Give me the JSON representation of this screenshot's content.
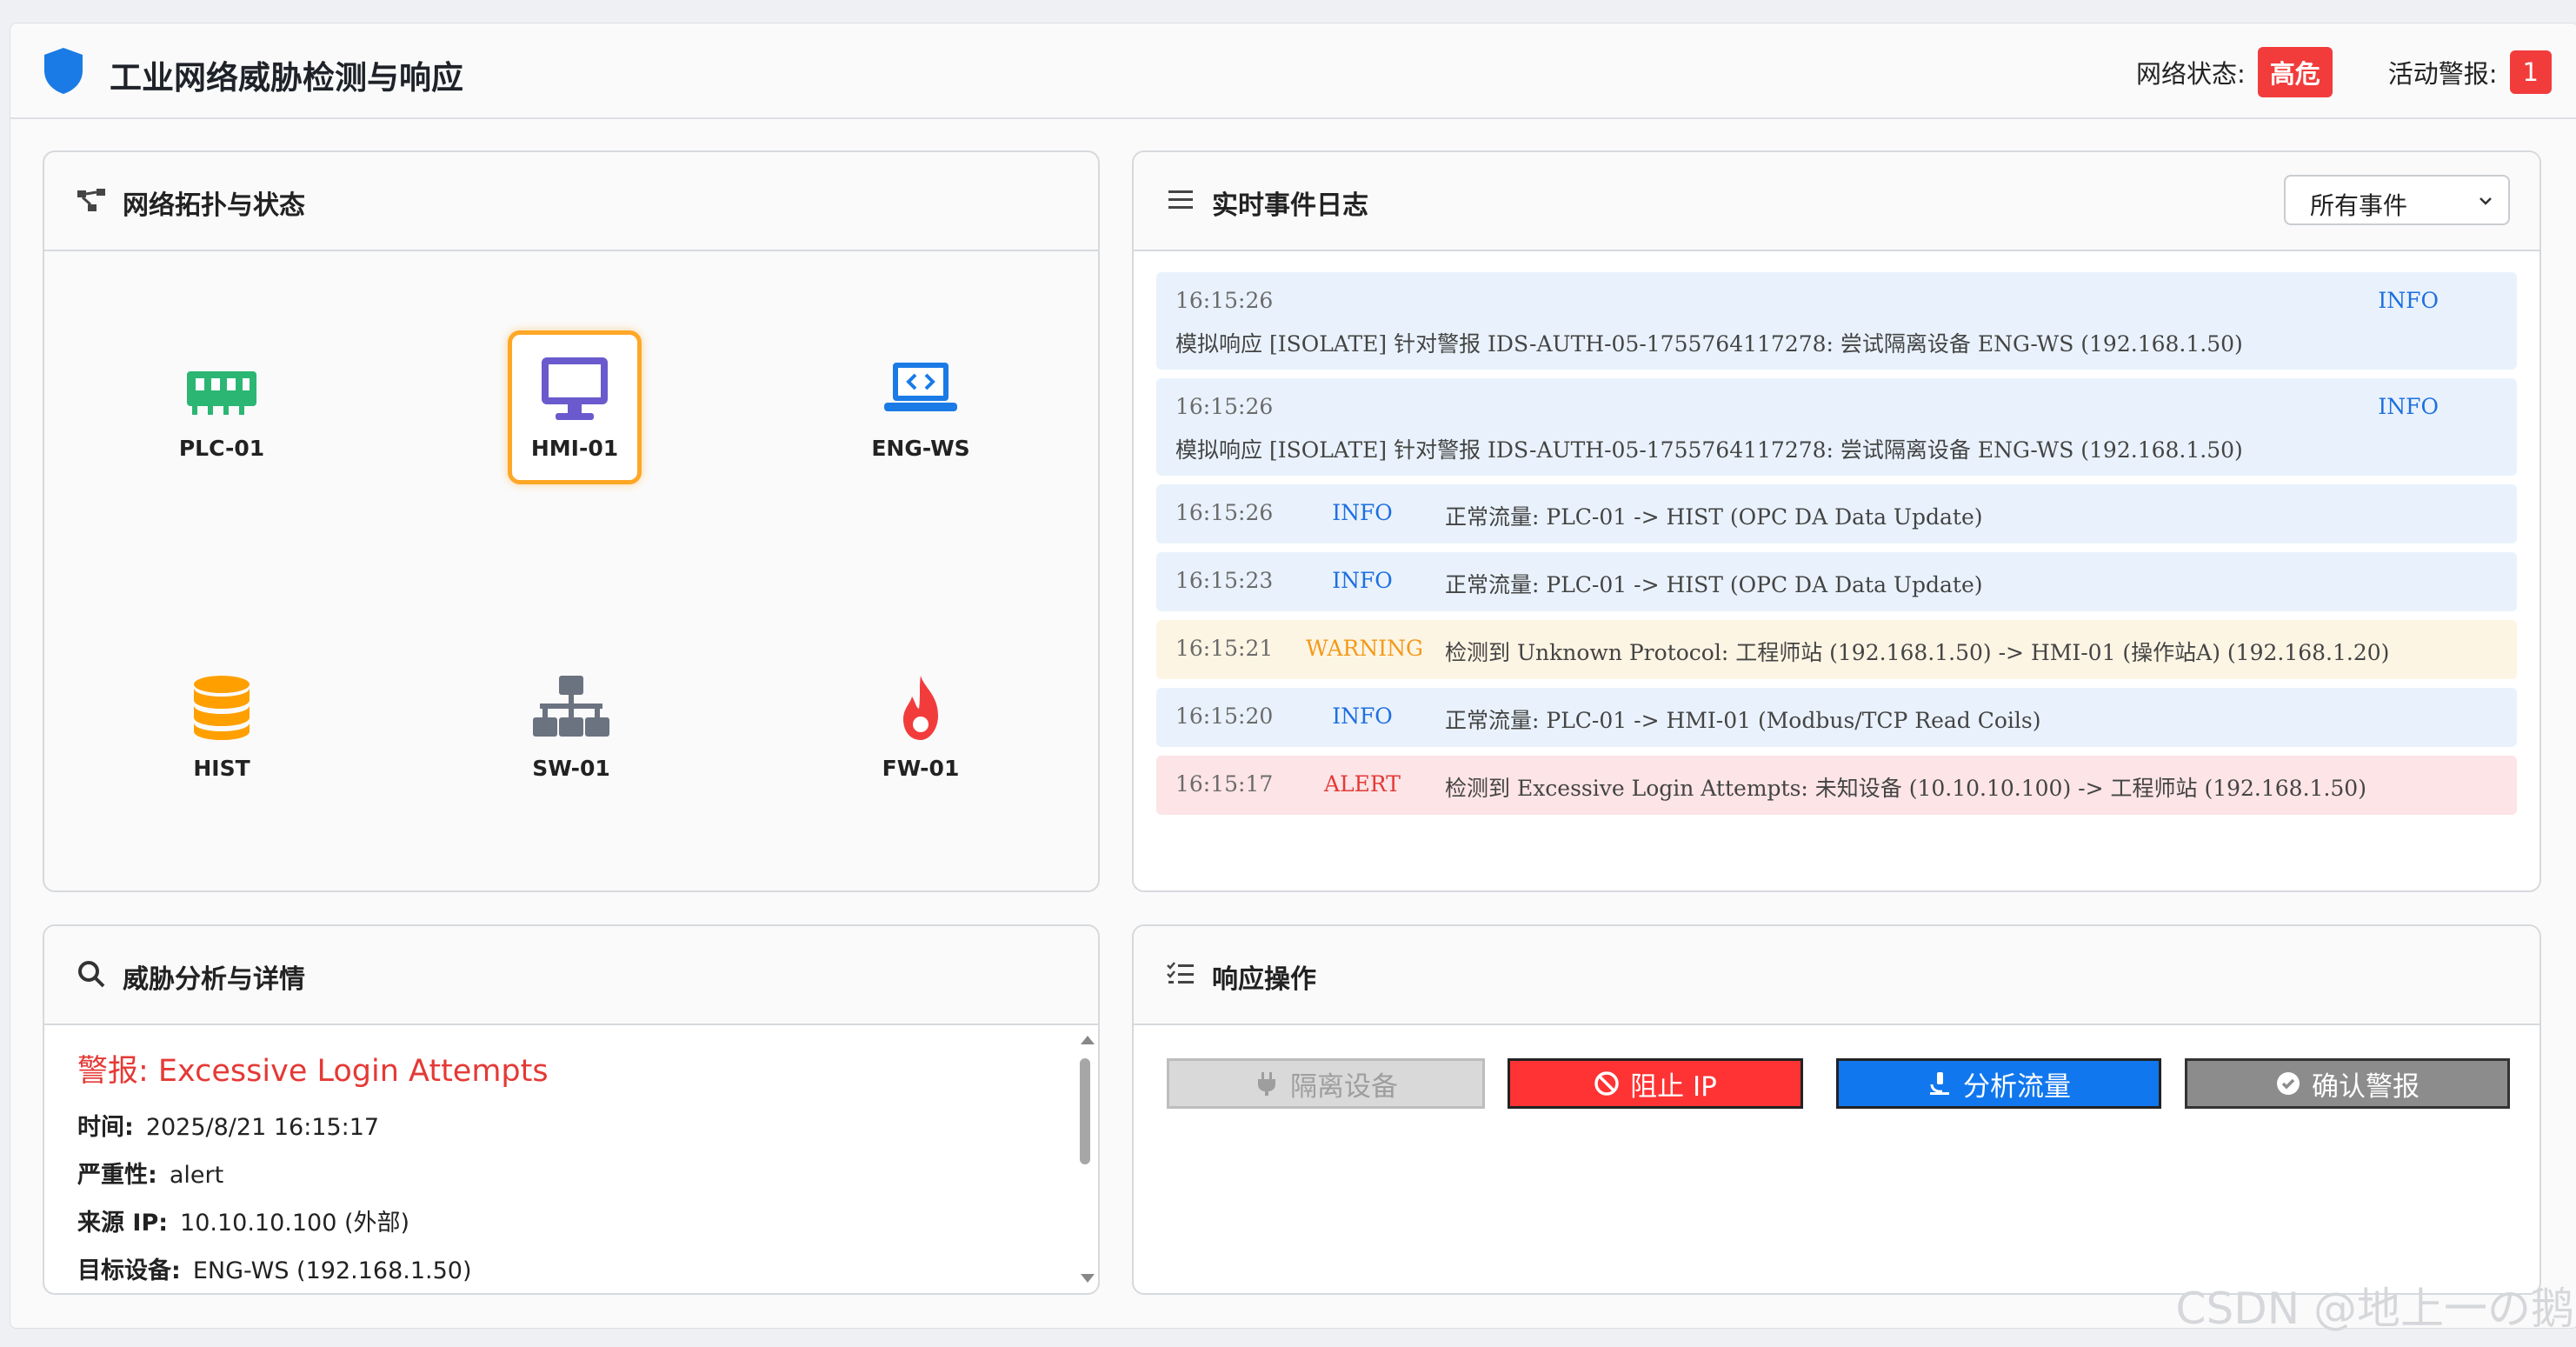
{
  "app": {
    "title": "工业网络威胁检测与响应"
  },
  "status": {
    "network_label": "网络状态:",
    "network_value": "高危",
    "alerts_label": "活动警报:",
    "alerts_count": "1"
  },
  "topology": {
    "title": "网络拓扑与状态",
    "nodes": [
      {
        "label": "PLC-01",
        "icon": "plc-icon",
        "color": "#2bb673"
      },
      {
        "label": "HMI-01",
        "icon": "monitor-icon",
        "color": "#6a5acd",
        "selected": true
      },
      {
        "label": "ENG-WS",
        "icon": "laptop-code-icon",
        "color": "#1a7be6"
      },
      {
        "label": "HIST",
        "icon": "database-icon",
        "color": "#ffa000"
      },
      {
        "label": "SW-01",
        "icon": "network-switch-icon",
        "color": "#6b7280"
      },
      {
        "label": "FW-01",
        "icon": "fire-icon",
        "color": "#f23c3c"
      }
    ]
  },
  "log": {
    "title": "实时事件日志",
    "filter_value": "所有事件",
    "entries": [
      {
        "time": "16:15:26",
        "level": "INFO",
        "message": "模拟响应 [ISOLATE] 针对警报 IDS-AUTH-05-1755764117278: 尝试隔离设备 ENG-WS (192.168.1.50)"
      },
      {
        "time": "16:15:26",
        "level": "INFO",
        "message": "模拟响应 [ISOLATE] 针对警报 IDS-AUTH-05-1755764117278: 尝试隔离设备 ENG-WS (192.168.1.50)"
      },
      {
        "time": "16:15:26",
        "level": "INFO",
        "message": "正常流量: PLC-01 -> HIST (OPC DA Data Update)"
      },
      {
        "time": "16:15:23",
        "level": "INFO",
        "message": "正常流量: PLC-01 -> HIST (OPC DA Data Update)"
      },
      {
        "time": "16:15:21",
        "level": "WARNING",
        "message": "检测到 Unknown Protocol: 工程师站 (192.168.1.50) -> HMI-01 (操作站A) (192.168.1.20)"
      },
      {
        "time": "16:15:20",
        "level": "INFO",
        "message": "正常流量: PLC-01 -> HMI-01 (Modbus/TCP Read Coils)"
      },
      {
        "time": "16:15:17",
        "level": "ALERT",
        "message": "检测到 Excessive Login Attempts: 未知设备 (10.10.10.100) -> 工程师站 (192.168.1.50)"
      }
    ]
  },
  "threat": {
    "title": "威胁分析与详情",
    "alert_title": "警报: Excessive Login Attempts",
    "rows": [
      {
        "label": "时间:",
        "value": "2025/8/21 16:15:17"
      },
      {
        "label": "严重性:",
        "value": "alert"
      },
      {
        "label": "来源 IP:",
        "value": "10.10.10.100 (外部)"
      },
      {
        "label": "目标设备:",
        "value": "ENG-WS (192.168.1.50)"
      }
    ]
  },
  "response": {
    "title": "响应操作",
    "buttons": {
      "isolate": "隔离设备",
      "block": "阻止 IP",
      "analyze": "分析流量",
      "ack": "确认警报"
    }
  },
  "watermark": "CSDN @地上一の鹅"
}
